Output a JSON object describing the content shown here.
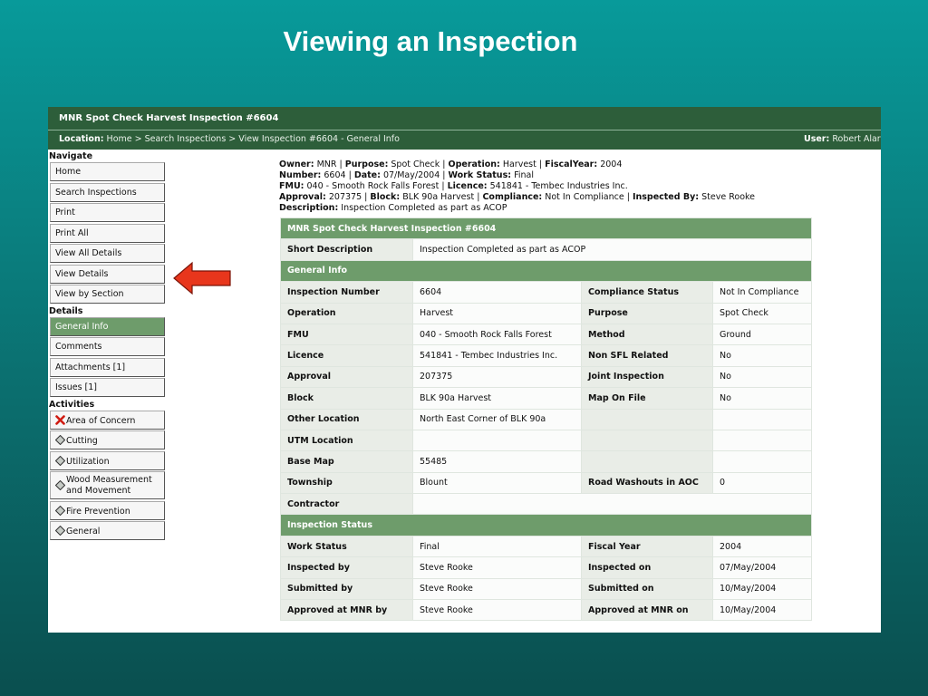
{
  "slide_title": "Viewing an Inspection",
  "app": {
    "title": "MNR Spot Check Harvest Inspection #6604",
    "location_label": "Location:",
    "breadcrumb": "Home > Search Inspections > View Inspection #6604 - General Info",
    "user_label": "User:",
    "user_value": "Robert Alar"
  },
  "sidebar": {
    "navigate_heading": "Navigate",
    "navigate": [
      "Home",
      "Search Inspections",
      "Print",
      "Print All",
      "View All Details",
      "View Details",
      "View by Section"
    ],
    "details_heading": "Details",
    "details": [
      "General Info",
      "Comments",
      "Attachments [1]",
      "Issues [1]"
    ],
    "activities_heading": "Activities",
    "activities": [
      {
        "label": "Area of Concern",
        "icon": "red-x-icon"
      },
      {
        "label": "Cutting",
        "icon": "diamond-icon"
      },
      {
        "label": "Utilization",
        "icon": "diamond-icon"
      },
      {
        "label": "Wood Measurement",
        "label2": "and Movement",
        "icon": "diamond-icon"
      },
      {
        "label": "Fire Prevention",
        "icon": "diamond-icon"
      },
      {
        "label": "General",
        "icon": "diamond-icon"
      }
    ]
  },
  "summary": {
    "owner_l": "Owner:",
    "owner": "MNR",
    "purpose_l": "Purpose:",
    "purpose": "Spot Check",
    "operation_l": "Operation:",
    "operation": "Harvest",
    "fiscal_l": "FiscalYear:",
    "fiscal": "2004",
    "number_l": "Number:",
    "number": "6604",
    "date_l": "Date:",
    "date": "07/May/2004",
    "work_l": "Work Status:",
    "work": "Final",
    "fmu_l": "FMU:",
    "fmu": "040 - Smooth Rock Falls Forest",
    "licence_l": "Licence:",
    "licence": "541841 - Tembec Industries Inc.",
    "approval_l": "Approval:",
    "approval": "207375",
    "block_l": "Block:",
    "block": "BLK 90a Harvest",
    "compliance_l": "Compliance:",
    "compliance": "Not In Compliance",
    "inspected_l": "Inspected By:",
    "inspected": "Steve Rooke",
    "desc_l": "Description:",
    "desc": "Inspection Completed as part as ACOP",
    "sep": " | "
  },
  "detail": {
    "title": "MNR Spot Check Harvest Inspection #6604",
    "short_desc_label": "Short Description",
    "short_desc": "Inspection Completed as part as ACOP",
    "general_info_heading": "General Info",
    "general_rows": [
      [
        "Inspection Number",
        "6604",
        "Compliance Status",
        "Not In Compliance"
      ],
      [
        "Operation",
        "Harvest",
        "Purpose",
        "Spot Check"
      ],
      [
        "FMU",
        "040 - Smooth Rock Falls Forest",
        "Method",
        "Ground"
      ],
      [
        "Licence",
        "541841 - Tembec Industries Inc.",
        "Non SFL Related",
        "No"
      ],
      [
        "Approval",
        "207375",
        "Joint Inspection",
        "No"
      ],
      [
        "Block",
        "BLK 90a Harvest",
        "Map On File",
        "No"
      ],
      [
        "Other Location",
        "North East Corner of BLK 90a",
        "",
        ""
      ],
      [
        "UTM Location",
        "",
        "",
        ""
      ],
      [
        "Base Map",
        "55485",
        "",
        ""
      ],
      [
        "Township",
        "Blount",
        "Road Washouts in AOC",
        "0"
      ]
    ],
    "contractor_label": "Contractor",
    "contractor": "",
    "status_heading": "Inspection Status",
    "status_rows": [
      [
        "Work Status",
        "Final",
        "Fiscal Year",
        "2004"
      ],
      [
        "Inspected by",
        "Steve Rooke",
        "Inspected on",
        "07/May/2004"
      ],
      [
        "Submitted by",
        "Steve Rooke",
        "Submitted on",
        "10/May/2004"
      ],
      [
        "Approved at MNR by",
        "Steve Rooke",
        "Approved at MNR on",
        "10/May/2004"
      ]
    ]
  },
  "colors": {
    "header_green": "#2d5e3a",
    "section_green": "#6e9c6b",
    "arrow_red": "#e8361c",
    "slide_bg_top": "#089a9a",
    "slide_bg_bottom": "#0a4f4f"
  }
}
